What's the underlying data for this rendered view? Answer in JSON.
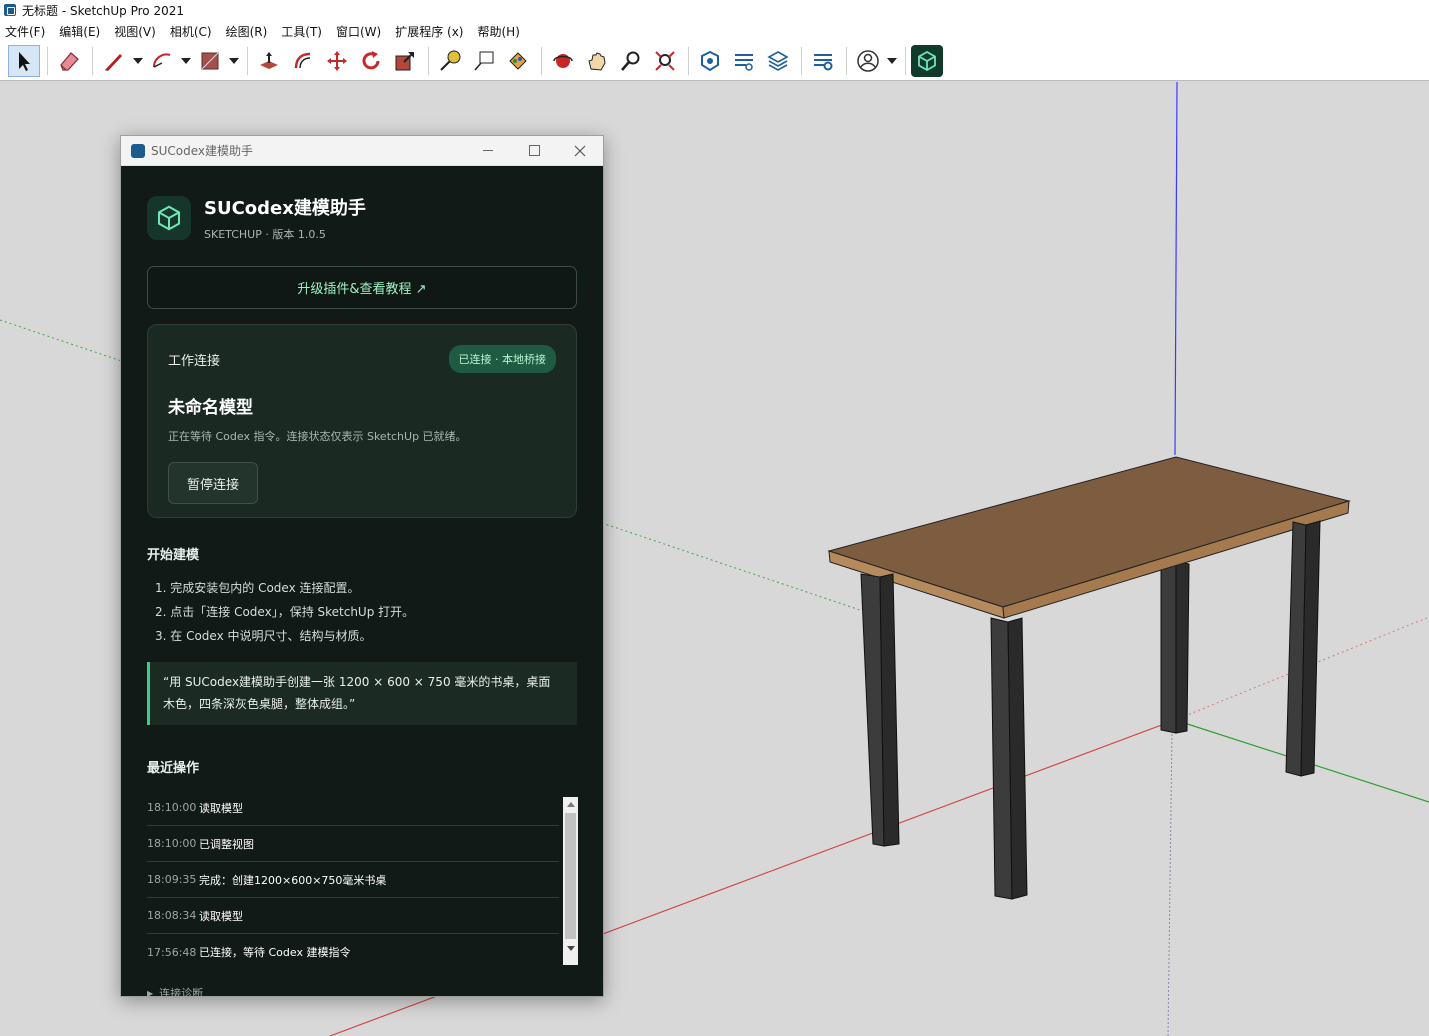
{
  "app": {
    "title": "无标题 - SketchUp Pro 2021"
  },
  "menu": [
    "文件(F)",
    "编辑(E)",
    "视图(V)",
    "相机(C)",
    "绘图(R)",
    "工具(T)",
    "窗口(W)",
    "扩展程序 (x)",
    "帮助(H)"
  ],
  "toolbar": {
    "tools": [
      "select-icon",
      "eraser-icon",
      "pencil-line-icon",
      "arc-icon",
      "rectangle-icon",
      "push-pull-icon",
      "offset-icon",
      "move-icon",
      "rotate-icon",
      "scale-icon",
      "tape-measure-icon",
      "text-icon",
      "paint-bucket-icon",
      "orbit-icon",
      "pan-icon",
      "zoom-icon",
      "zoom-extents-icon",
      "warehouse-icon",
      "extension-warehouse-icon",
      "layout-icon",
      "extension-manager-icon",
      "account-icon",
      "sucodex-icon"
    ]
  },
  "plugin": {
    "window_title": "SUCodex建模助手",
    "brand_name": "SUCodex建模助手",
    "brand_sub": "SKETCHUP · 版本 1.0.5",
    "upgrade_label": "升级插件&查看教程 ↗",
    "connection": {
      "label": "工作连接",
      "badge": "已连接 · 本地桥接",
      "model_name": "未命名模型",
      "description": "正在等待 Codex 指令。连接状态仅表示 SketchUp 已就绪。",
      "pause_label": "暂停连接"
    },
    "start_title": "开始建模",
    "steps": [
      "1. 完成安装包内的 Codex 连接配置。",
      "2. 点击「连接 Codex」，保持 SketchUp 打开。",
      "3. 在 Codex 中说明尺寸、结构与材质。"
    ],
    "quote_line1": "“用 SUCodex建模助手创建一张 1200 × 600 × 750 毫米的书桌，桌面",
    "quote_line2": "木色，四条深灰色桌腿，整体成组。”",
    "recent_title": "最近操作",
    "recent": [
      {
        "time": "18:10:00",
        "text": "读取模型"
      },
      {
        "time": "18:10:00",
        "text": "已调整视图"
      },
      {
        "time": "18:09:35",
        "text": "完成：创建1200×600×750毫米书桌"
      },
      {
        "time": "18:08:34",
        "text": "读取模型"
      },
      {
        "time": "17:56:48",
        "text": "已连接，等待 Codex 建模指令"
      }
    ],
    "diagnostics_label": "连接诊断"
  },
  "colors": {
    "panel_bg": "#111a17",
    "accent_green": "#3fcb8d",
    "table_top": "#7d5c3f",
    "table_edge": "#b58a5d",
    "table_leg": "#3a3a3a",
    "axis_red": "#d22",
    "axis_green": "#2a2",
    "axis_blue": "#22d"
  }
}
